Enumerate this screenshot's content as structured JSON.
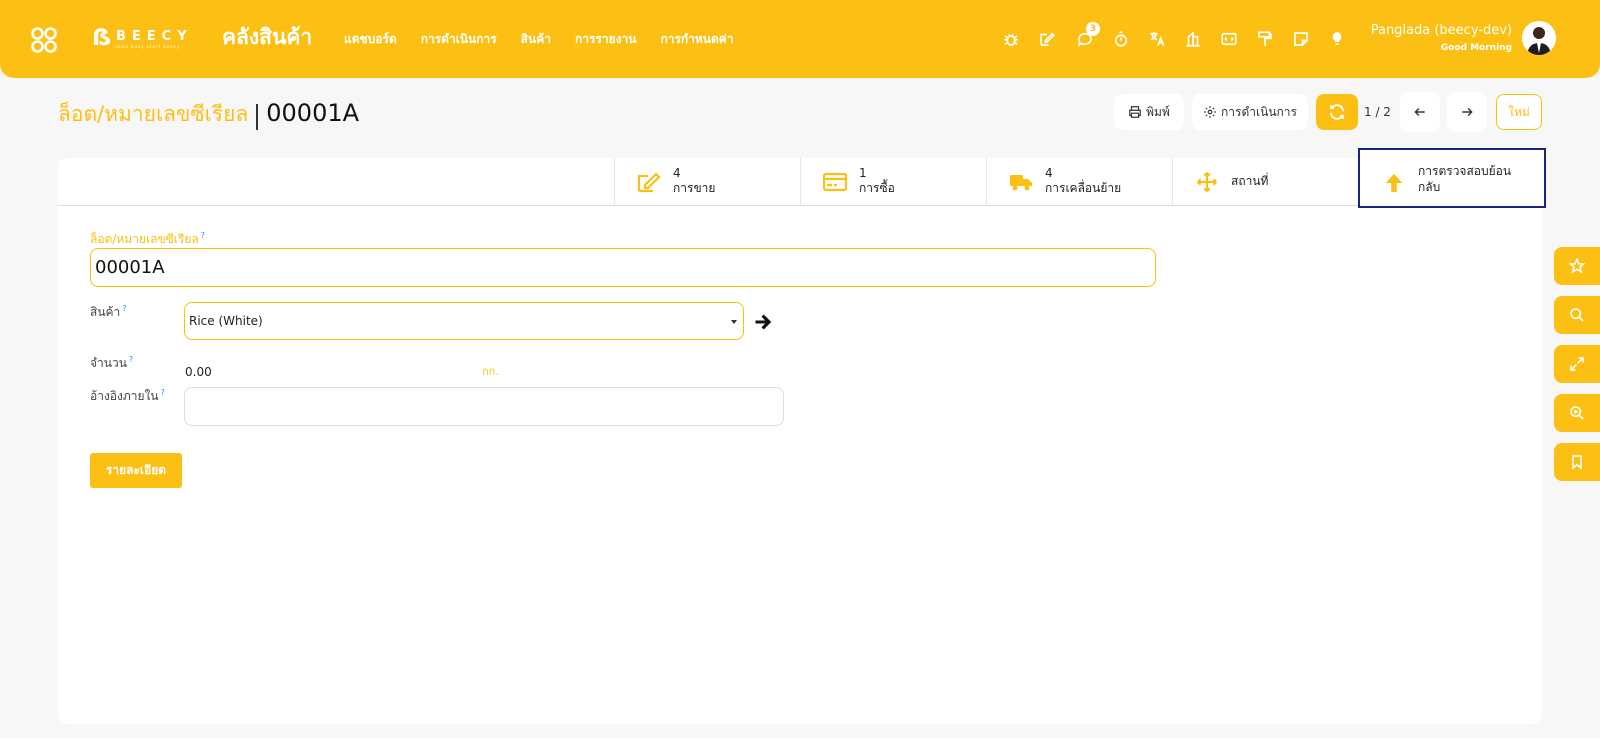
{
  "header": {
    "apps_icon": "apps-grid-icon",
    "logo_text": "BEECY",
    "logo_tagline": "step busy start beecy",
    "app_title": "คลังสินค้า",
    "nav": [
      "แดชบอร์ด",
      "การดำเนินการ",
      "สินค้า",
      "การรายงาน",
      "การกำหนดค่า"
    ],
    "icons": [
      "bug-icon",
      "edit-icon",
      "chat-icon",
      "timer-icon",
      "translate-icon",
      "building-icon",
      "code-icon",
      "paint-roller-icon",
      "note-icon",
      "lightbulb-icon"
    ],
    "chat_badge": "3",
    "user_name": "Panglada (beecy-dev)",
    "greeting": "Good Morning"
  },
  "breadcrumb": {
    "parent": "ล็อต/หมายเลขซีเรียล",
    "current": "00001A"
  },
  "actions": {
    "print_label": "พิมพ์",
    "action_label": "การดำเนินการ",
    "pager": "1 / 2",
    "new_label": "ใหม่"
  },
  "stats": [
    {
      "icon": "edit-icon",
      "count": "4",
      "label": "การขาย"
    },
    {
      "icon": "credit-card-icon",
      "count": "1",
      "label": "การซื้อ"
    },
    {
      "icon": "truck-icon",
      "count": "4",
      "label": "การเคลื่อนย้าย"
    },
    {
      "icon": "move-icon",
      "label": "สถานที่"
    },
    {
      "icon": "arrow-up-icon",
      "label_line1": "การตรวจสอบย้อน",
      "label_line2": "กลับ"
    }
  ],
  "form": {
    "lot_label": "ล็อต/หมายเลขซีเรียล",
    "lot_value": "00001A",
    "product_label": "สินค้า",
    "product_value": "Rice (White)",
    "qty_label": "จำนวน",
    "qty_value": "0.00",
    "qty_unit": "กก.",
    "ref_label": "อ้างอิงภายใน",
    "ref_value": "",
    "help_mark": "?",
    "detail_button": "รายละเอียด"
  },
  "colors": {
    "accent": "#fbc013",
    "active_border": "#1a237e"
  },
  "side_buttons": [
    "star-icon",
    "search-icon",
    "expand-icon",
    "zoom-in-icon",
    "bookmark-icon"
  ]
}
